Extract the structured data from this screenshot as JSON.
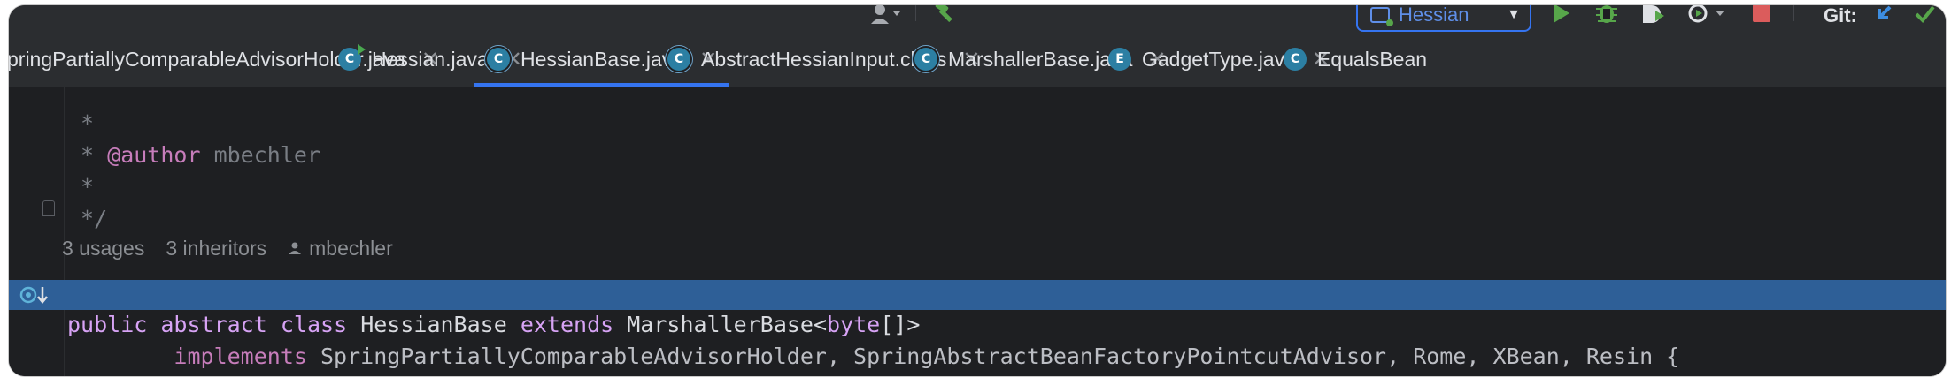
{
  "toolbar": {
    "run_config_name": "Hessian",
    "git_label": "Git:",
    "icons": [
      "profile-icon",
      "build-hammer-icon",
      "run-config-icon",
      "run-icon",
      "debug-icon",
      "coverage-icon",
      "profiler-icon",
      "stop-icon",
      "vcs-update-icon",
      "vcs-commit-icon"
    ]
  },
  "tabs": [
    {
      "label": "pringPartiallyComparableAdvisorHolder.java",
      "icon": "none",
      "active": false
    },
    {
      "label": "Hessian.java",
      "icon": "class-runnable-icon",
      "active": false
    },
    {
      "label": "HessianBase.java",
      "icon": "abstract-class-icon",
      "active": true
    },
    {
      "label": "AbstractHessianInput.class",
      "icon": "abstract-class-icon",
      "active": false
    },
    {
      "label": "MarshallerBase.java",
      "icon": "abstract-class-icon",
      "active": false
    },
    {
      "label": "GadgetType.java",
      "icon": "enum-icon",
      "active": false
    },
    {
      "label": "EqualsBean",
      "icon": "class-icon",
      "active": false
    }
  ],
  "tab_icon_letters": {
    "class": "C",
    "enum": "E"
  },
  "editor": {
    "lines": [
      {
        "doc1": " *"
      },
      {
        "doc1": " * ",
        "tag": "@author",
        "doc2": " mbechler"
      },
      {
        "doc1": " *"
      },
      {
        "doc1": " */"
      }
    ],
    "inlay": {
      "usages": "3 usages",
      "inheritors": "3 inheritors",
      "author": "mbechler"
    },
    "decl": {
      "kw_public": "public",
      "kw_abstract": "abstract",
      "kw_class": "class",
      "class_name": "HessianBase",
      "kw_extends": "extends",
      "super_name": "MarshallerBase<",
      "kw_byte": "byte",
      "super_close": "[]>"
    },
    "impl": {
      "indent": "        ",
      "kw_implements": "implements",
      "interfaces": "SpringPartiallyComparableAdvisorHolder, SpringAbstractBeanFactoryPointcutAdvisor, Rome, XBean, Resin {"
    }
  },
  "colors": {
    "editor_bg": "#1e1f22",
    "highlight_line": "#2e5f97",
    "accent": "#3574f0",
    "keyword": "#cf8e6d",
    "doc_tag": "#c77dbb"
  }
}
